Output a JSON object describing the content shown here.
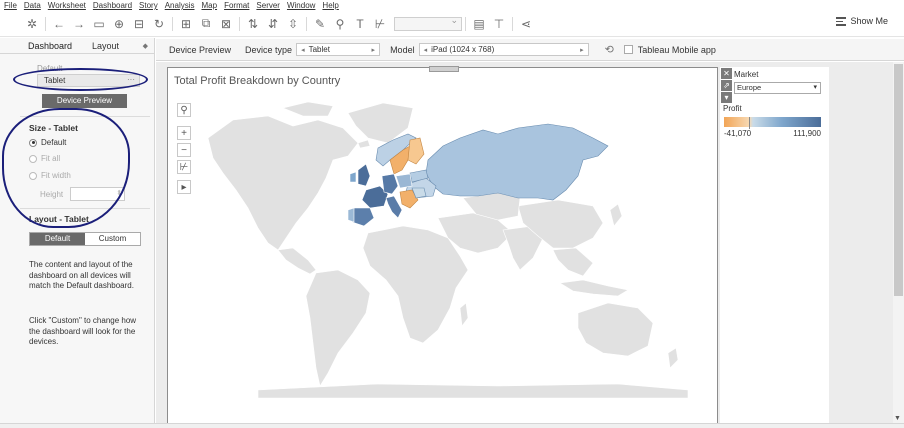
{
  "menu": [
    "File",
    "Data",
    "Worksheet",
    "Dashboard",
    "Story",
    "Analysis",
    "Map",
    "Format",
    "Server",
    "Window",
    "Help"
  ],
  "toolbar": {
    "show_me_label": "Show Me"
  },
  "left_panel": {
    "tabs": [
      "Dashboard",
      "Layout"
    ],
    "device_label": "Default",
    "device_value": "Tablet",
    "device_dots": "···",
    "preview_button": "Device Preview",
    "size_title": "Size - Tablet",
    "size_options": [
      "Default",
      "Fit all",
      "Fit width"
    ],
    "height_label": "Height",
    "layout_title": "Layout - Tablet",
    "layout_options": [
      "Default",
      "Custom"
    ],
    "desc1": "The content and layout of the dashboard on all devices will match the Default dashboard.",
    "desc2": "Click \"Custom\" to change how the dashboard will look for the devices."
  },
  "device_bar": {
    "preview_tab": "Device Preview",
    "device_type_label": "Device type",
    "device_type_value": "Tablet",
    "model_label": "Model",
    "model_value": "iPad (1024 x 768)",
    "mobile_app_label": "Tableau Mobile app"
  },
  "dashboard": {
    "title": "Total Profit Breakdown by Country"
  },
  "legend": {
    "market_title": "Market",
    "market_value": "Europe",
    "profit_title": "Profit",
    "min_label": "-41,070",
    "max_label": "111,900"
  },
  "colors": {
    "negative": "#f2a556",
    "positive_light": "#c9dbe8",
    "positive_dark": "#4b6d99",
    "land_gray": "#e1e1e1",
    "annotation": "#1b1f7a"
  }
}
